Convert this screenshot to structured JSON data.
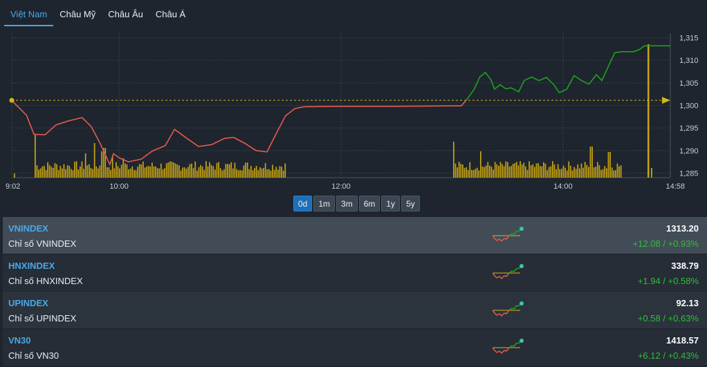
{
  "tabs": [
    "Việt Nam",
    "Châu Mỹ",
    "Châu Âu",
    "Châu Á"
  ],
  "active_tab": 0,
  "ranges": [
    "0d",
    "1m",
    "3m",
    "6m",
    "1y",
    "5y"
  ],
  "active_range": 0,
  "colors": {
    "up": "#1fa11f",
    "down": "#e55a4e",
    "reference": "#d8b41a",
    "volume": "#c9a50f",
    "change_text": "#2fbf3a",
    "accent": "#4aa8e8"
  },
  "chart_data": {
    "type": "line",
    "series_name": "VNINDEX",
    "x_ticks": [
      "9:02",
      "10:00",
      "12:00",
      "14:00",
      "14:58"
    ],
    "y_ticks": [
      "1,285",
      "1,290",
      "1,295",
      "1,300",
      "1,305",
      "1,310",
      "1,315"
    ],
    "ylim": [
      1284,
      1316
    ],
    "reference": 1301.12,
    "close": 1313.2,
    "grid": true,
    "line_points": [
      [
        "9:02",
        1301.1
      ],
      [
        "9:10",
        1297.8
      ],
      [
        "9:14",
        1293.6
      ],
      [
        "9:20",
        1293.5
      ],
      [
        "9:26",
        1295.7
      ],
      [
        "9:33",
        1296.6
      ],
      [
        "9:40",
        1297.3
      ],
      [
        "9:45",
        1295.3
      ],
      [
        "9:50",
        1291.4
      ],
      [
        "9:55",
        1286.9
      ],
      [
        "9:57",
        1289.3
      ],
      [
        "10:00",
        1288.4
      ],
      [
        "10:05",
        1287.5
      ],
      [
        "10:12",
        1288.1
      ],
      [
        "10:18",
        1289.9
      ],
      [
        "10:25",
        1291.1
      ],
      [
        "10:30",
        1294.7
      ],
      [
        "10:37",
        1292.6
      ],
      [
        "10:43",
        1290.9
      ],
      [
        "10:50",
        1291.3
      ],
      [
        "10:57",
        1292.7
      ],
      [
        "11:02",
        1292.9
      ],
      [
        "11:08",
        1291.6
      ],
      [
        "11:14",
        1290.0
      ],
      [
        "11:20",
        1289.7
      ],
      [
        "11:24",
        1293.0
      ],
      [
        "11:30",
        1297.7
      ],
      [
        "11:35",
        1299.3
      ],
      [
        "11:40",
        1299.7
      ],
      [
        "12:00",
        1299.8
      ],
      [
        "12:30",
        1299.8
      ],
      [
        "13:00",
        1299.9
      ],
      [
        "13:05",
        1299.9
      ],
      [
        "13:08",
        1301.3
      ],
      [
        "13:12",
        1303.6
      ],
      [
        "13:15",
        1306.3
      ],
      [
        "13:18",
        1307.3
      ],
      [
        "13:21",
        1305.7
      ],
      [
        "13:23",
        1303.6
      ],
      [
        "13:26",
        1304.6
      ],
      [
        "13:29",
        1303.7
      ],
      [
        "13:32",
        1303.9
      ],
      [
        "13:36",
        1303.0
      ],
      [
        "13:39",
        1305.5
      ],
      [
        "13:43",
        1306.3
      ],
      [
        "13:47",
        1305.5
      ],
      [
        "13:51",
        1306.2
      ],
      [
        "13:55",
        1304.6
      ],
      [
        "13:58",
        1302.8
      ],
      [
        "14:02",
        1303.6
      ],
      [
        "14:06",
        1306.6
      ],
      [
        "14:10",
        1305.5
      ],
      [
        "14:14",
        1304.7
      ],
      [
        "14:18",
        1306.8
      ],
      [
        "14:21",
        1305.5
      ],
      [
        "14:25",
        1309.1
      ],
      [
        "14:28",
        1311.7
      ],
      [
        "14:32",
        1311.9
      ],
      [
        "14:38",
        1311.9
      ],
      [
        "14:41",
        1312.3
      ],
      [
        "14:44",
        1313.2
      ],
      [
        "14:50",
        1313.2
      ],
      [
        "14:58",
        1313.2
      ]
    ]
  },
  "indices": [
    {
      "symbol": "VNINDEX",
      "name": "Chỉ số VNINDEX",
      "value": "1313.20",
      "change": "+12.08 / +0.93%"
    },
    {
      "symbol": "HNXINDEX",
      "name": "Chỉ số HNXINDEX",
      "value": "338.79",
      "change": "+1.94 / +0.58%"
    },
    {
      "symbol": "UPINDEX",
      "name": "Chỉ số UPINDEX",
      "value": "92.13",
      "change": "+0.58 / +0.63%"
    },
    {
      "symbol": "VN30",
      "name": "Chỉ số VN30",
      "value": "1418.57",
      "change": "+6.12 / +0.43%"
    }
  ]
}
